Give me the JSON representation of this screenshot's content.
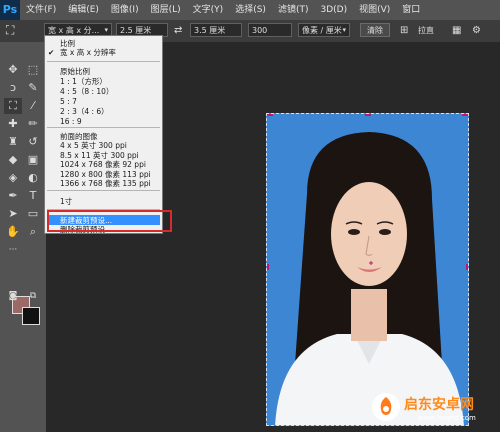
{
  "app": {
    "logo": "Ps"
  },
  "menubar": [
    "文件(F)",
    "编辑(E)",
    "图像(I)",
    "图层(L)",
    "文字(Y)",
    "选择(S)",
    "滤镜(T)",
    "3D(D)",
    "视图(V)",
    "窗口"
  ],
  "options": {
    "ratio_label": "宽 x 高 x 分...",
    "width_value": "2.5 厘米",
    "swap_icon": "swap-icon",
    "height_value": "3.5 厘米",
    "resolution_value": "300",
    "unit_label": "像素 / 厘米",
    "clear_label": "清除",
    "straighten_label": "拉直"
  },
  "dropdown": {
    "group1_header": "比例",
    "item_checked": "宽 x 高 x 分辨率",
    "group2_header": "原始比例",
    "ratios": [
      "1 : 1（方形）",
      "4 : 5（8 : 10）",
      "5 : 7",
      "2 : 3（4 : 6）",
      "16 : 9"
    ],
    "group3_header": "前面的图像",
    "presets": [
      "4 x 5 英寸 300 ppi",
      "8.5 x 11 英寸 300 ppi",
      "1024 x 768 像素 92 ppi",
      "1280 x 800 像素 113 ppi",
      "1366 x 768 像素 135 ppi"
    ],
    "custom": "1寸",
    "new_preset": "新建裁剪预设...",
    "delete_preset": "删除裁剪预设..."
  },
  "watermark": {
    "brand": "启东安卓网",
    "url": "www.hxqnd.com"
  },
  "colors": {
    "accent": "#31a8ff",
    "highlight": "#3390ff",
    "photo_bg": "#3d86d3",
    "annotation": "#d42b2b"
  }
}
